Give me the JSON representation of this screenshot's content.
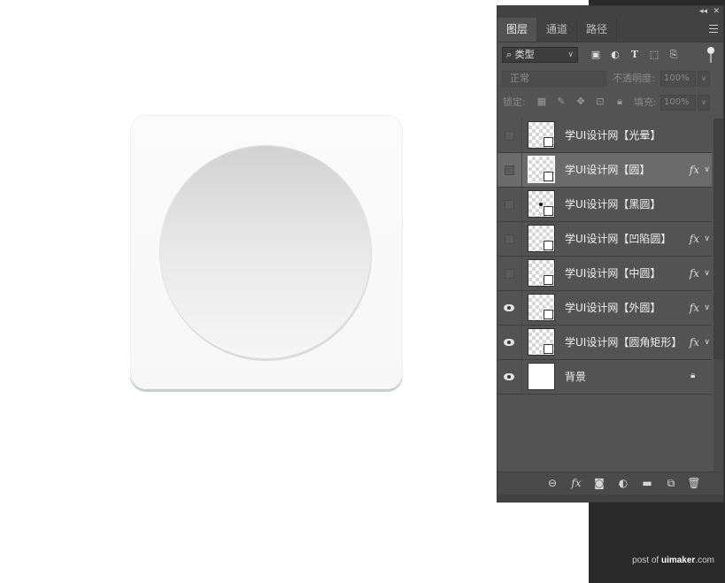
{
  "panel": {
    "tabs": [
      {
        "label": "图层",
        "active": true
      },
      {
        "label": "通道",
        "active": false
      },
      {
        "label": "路径",
        "active": false
      }
    ],
    "filter": {
      "label": "类型"
    },
    "blend_mode": "正常",
    "opacity": {
      "label": "不透明度:",
      "value": "100%"
    },
    "lock": {
      "label": "锁定:"
    },
    "fill": {
      "label": "填充:",
      "value": "100%"
    },
    "layers": [
      {
        "name": "学UI设计网【光晕】",
        "visible": false,
        "fx": false,
        "selected": false,
        "thumb": "transparent"
      },
      {
        "name": "学UI设计网【圆】",
        "visible": false,
        "fx": true,
        "selected": true,
        "thumb": "transparent"
      },
      {
        "name": "学UI设计网【黑圆】",
        "visible": false,
        "fx": false,
        "selected": false,
        "thumb": "dot"
      },
      {
        "name": "学UI设计网【凹陷圆】",
        "visible": false,
        "fx": true,
        "selected": false,
        "thumb": "transparent"
      },
      {
        "name": "学UI设计网【中圆】",
        "visible": false,
        "fx": true,
        "selected": false,
        "thumb": "transparent"
      },
      {
        "name": "学UI设计网【外圆】",
        "visible": true,
        "fx": true,
        "selected": false,
        "thumb": "transparent"
      },
      {
        "name": "学UI设计网【圆角矩形】",
        "visible": true,
        "fx": true,
        "selected": false,
        "thumb": "transparent"
      },
      {
        "name": "背景",
        "visible": true,
        "fx": false,
        "selected": false,
        "thumb": "white",
        "locked": true
      }
    ],
    "fx_label": "fx"
  },
  "watermark": {
    "prefix": "post of ",
    "brand": "uimaker",
    "suffix": ".com"
  },
  "colors": {
    "panel_bg": "#535353",
    "panel_dark": "#424242",
    "selected_row": "#6b6b6b"
  }
}
